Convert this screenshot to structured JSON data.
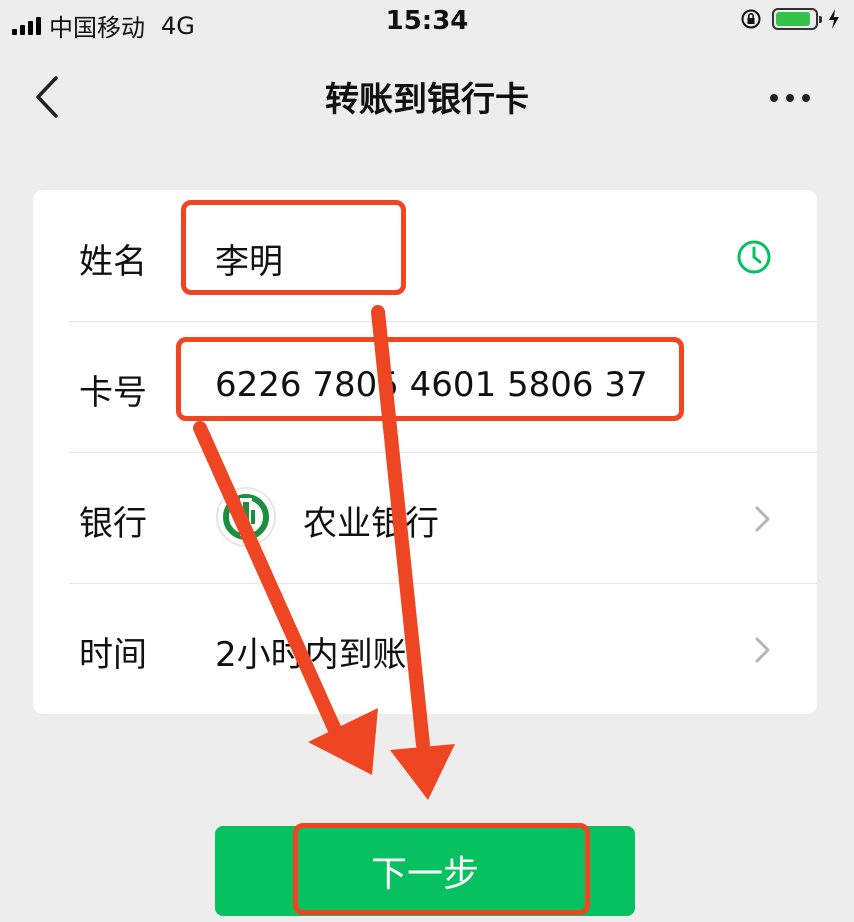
{
  "status_bar": {
    "carrier": "中国移动",
    "network": "4G",
    "time": "15:34"
  },
  "nav": {
    "title": "转账到银行卡",
    "back_icon": "chevron-left-icon",
    "more_icon": "ellipsis-icon"
  },
  "form": {
    "rows": [
      {
        "label": "姓名",
        "value": "李明",
        "icon": "clock-icon"
      },
      {
        "label": "卡号",
        "value": "6226 7805 4601 5806 37"
      },
      {
        "label": "银行",
        "value": "农业银行",
        "icon": "abc-bank-logo"
      },
      {
        "label": "时间",
        "value": "2小时内到账",
        "icon": "chevron-right-icon"
      }
    ]
  },
  "next_button": {
    "label": "下一步"
  },
  "colors": {
    "accent": "#07c160",
    "annotation": "#ee4523",
    "background": "#ededed",
    "bank_logo": "#1a8f3f"
  }
}
